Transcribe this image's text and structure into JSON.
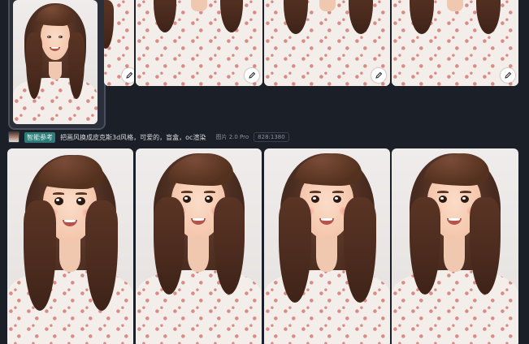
{
  "reference": {
    "tag": "智能参考",
    "prompt": "把画风换成皮克斯3d风格，可爱的，盲盒，oc渲染",
    "model": "图片 2.0 Pro",
    "ratio": "828:1380"
  },
  "top_row": {
    "thumbnails": [
      {
        "style": "photo",
        "selected": true
      },
      {
        "style": "photo-cropped",
        "has_edit": true
      },
      {
        "style": "photo-cropped",
        "has_edit": true
      },
      {
        "style": "photo-cropped",
        "has_edit": true
      },
      {
        "style": "photo-cropped",
        "has_edit": true
      }
    ]
  },
  "bottom_row": {
    "results": [
      {
        "style": "pixar-3d"
      },
      {
        "style": "pixar-3d"
      },
      {
        "style": "pixar-3d"
      },
      {
        "style": "pixar-3d"
      }
    ]
  },
  "icons": {
    "edit": "pencil-icon",
    "reference_thumb": "reference-image-icon"
  },
  "colors": {
    "background": "#1b1f27",
    "tag_bg": "#2e7d7a",
    "hair": "#4a2c20",
    "skin": "#f4c6ab",
    "shirt": "#f4eeea",
    "print": "#d98b86"
  }
}
